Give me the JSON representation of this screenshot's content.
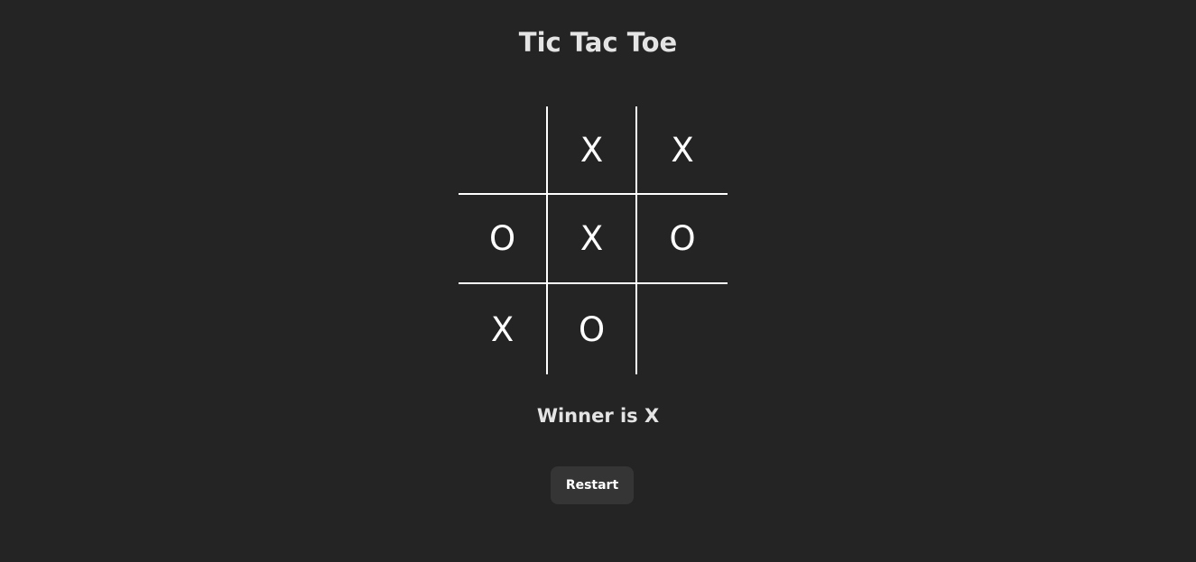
{
  "title": "Tic Tac Toe",
  "board": {
    "cells": [
      "",
      "X",
      "X",
      "O",
      "X",
      "O",
      "X",
      "O",
      ""
    ]
  },
  "status": "Winner is X",
  "restart_label": "Restart",
  "colors": {
    "background": "#242424",
    "grid_line": "#ffffff",
    "button_bg": "#353535"
  }
}
